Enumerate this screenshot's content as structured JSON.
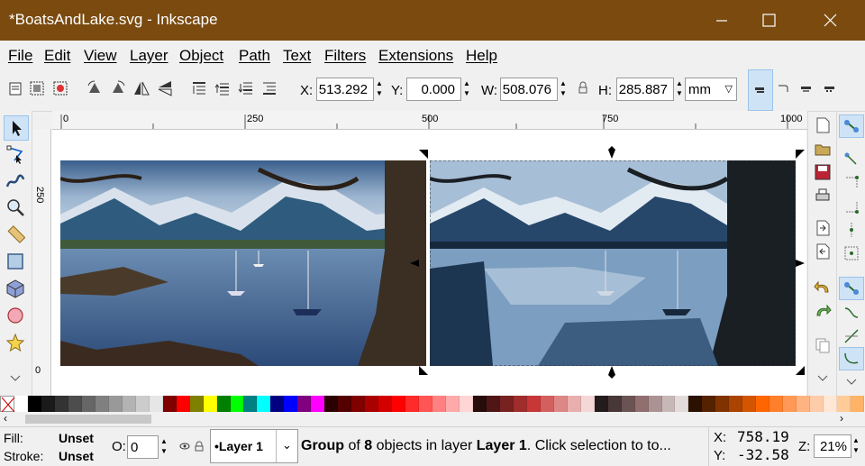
{
  "window": {
    "title": "*BoatsAndLake.svg - Inkscape",
    "title_bar_color": "#7a4a0f"
  },
  "menu": [
    "File",
    "Edit",
    "View",
    "Layer",
    "Object",
    "Path",
    "Text",
    "Filters",
    "Extensions",
    "Help"
  ],
  "toolbar": {
    "x_label": "X:",
    "x_value": "513.292",
    "y_label": "Y:",
    "y_value": "0.000",
    "w_label": "W:",
    "w_value": "508.076",
    "h_label": "H:",
    "h_value": "285.887",
    "unit": "mm"
  },
  "ruler": {
    "h_labels": [
      "0",
      "250",
      "500",
      "750",
      "1000"
    ],
    "v_labels": [
      "0",
      "250"
    ],
    "v_bottom": "0"
  },
  "canvas": {
    "left_image": "color-photo-lake-boats",
    "right_image": "posterized-photo-lake-boats"
  },
  "palette": [
    "#ffffff",
    "#000000",
    "#1a1a1a",
    "#333333",
    "#4d4d4d",
    "#666666",
    "#808080",
    "#999999",
    "#b3b3b3",
    "#cccccc",
    "#e6e6e6",
    "#800000",
    "#ff0000",
    "#808000",
    "#ffff00",
    "#008000",
    "#00ff00",
    "#008080",
    "#00ffff",
    "#000080",
    "#0000ff",
    "#800080",
    "#ff00ff",
    "#2b0000",
    "#550000",
    "#800000",
    "#aa0000",
    "#d40000",
    "#ff0000",
    "#ff2a2a",
    "#ff5555",
    "#ff8080",
    "#ffaaaa",
    "#ffd5d5",
    "#280b0b",
    "#501616",
    "#782121",
    "#a02c2c",
    "#c83737",
    "#d35f5f",
    "#de8787",
    "#e9afaf",
    "#f4d7d7",
    "#241c1c",
    "#483737",
    "#6c5353",
    "#916f6f",
    "#ac9393",
    "#c8b7b7",
    "#e3dbdb",
    "#2b1100",
    "#552200",
    "#803300",
    "#aa4400",
    "#d45500",
    "#ff6600",
    "#ff7f2a",
    "#ff9955",
    "#ffb380",
    "#ffccaa",
    "#ffe6d5",
    "#ffcc99",
    "#ffb366"
  ],
  "status": {
    "fill_label": "Fill:",
    "fill_value": "Unset",
    "stroke_label": "Stroke:",
    "stroke_value": "Unset",
    "opacity_label": "O:",
    "opacity_value": "0",
    "layer": "•Layer 1",
    "message_type": "Group",
    "message_pre": " of ",
    "message_count": "8",
    "message_mid": " objects in layer ",
    "message_layer": "Layer 1",
    "message_post": ". Click selection to to...",
    "x_label": "X:",
    "x_value": "758.19",
    "y_label": "Y:",
    "y_value": "-32.58",
    "zoom_label": "Z:",
    "zoom_value": "21%"
  }
}
